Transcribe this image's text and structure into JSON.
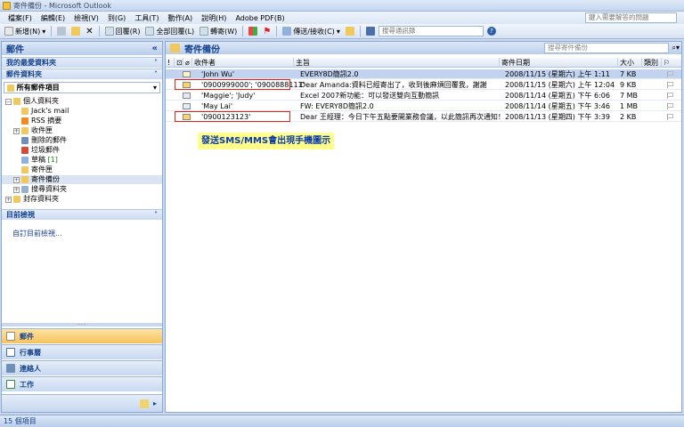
{
  "window": {
    "title": "寄件備份 - Microsoft Outlook"
  },
  "menu": [
    "檔案(F)",
    "編輯(E)",
    "檢視(V)",
    "到(G)",
    "工具(T)",
    "動作(A)",
    "說明(H)",
    "Adobe PDF(B)"
  ],
  "help": {
    "placeholder": "鍵入需要解答的問題"
  },
  "toolbar": {
    "new": "新增(N)",
    "reply": "回覆(R)",
    "reply_all": "全部回覆(L)",
    "forward": "轉寄(W)",
    "send_receive": "傳送/接收(C)",
    "address_book": "搜尋通訊錄"
  },
  "nav": {
    "title": "郵件",
    "favorites": "我的最愛資料夾",
    "mail_folders": "郵件資料夾",
    "all_items": "所有郵件項目",
    "tree": [
      {
        "label": "個人資料夾",
        "count": ""
      },
      {
        "label": "Jack's mail",
        "count": ""
      },
      {
        "label": "RSS 摘要",
        "count": ""
      },
      {
        "label": "收件匣",
        "count": ""
      },
      {
        "label": "刪除的郵件",
        "count": ""
      },
      {
        "label": "垃圾郵件",
        "count": ""
      },
      {
        "label": "草稿",
        "count": "[1]"
      },
      {
        "label": "寄件匣",
        "count": ""
      },
      {
        "label": "寄件備份",
        "count": ""
      },
      {
        "label": "搜尋資料夾",
        "count": ""
      },
      {
        "label": "封存資料夾",
        "count": ""
      }
    ],
    "current_view": "目前檢視",
    "customize_view": "自訂目前檢視...",
    "buttons": [
      "郵件",
      "行事曆",
      "連絡人",
      "工作"
    ]
  },
  "main": {
    "title": "寄件備份",
    "search_placeholder": "搜尋寄件備份",
    "columns": {
      "to": "收件者",
      "subject": "主旨",
      "date": "寄件日期",
      "size": "大小",
      "category": "類別"
    },
    "rows": [
      {
        "to": "'John Wu'",
        "subject": "EVERY8D簡訊2.0",
        "date": "2008/11/15 (星期六) 上午 1:11",
        "size": "7 KB"
      },
      {
        "to": "'0900999000'; '0900888111'",
        "subject": "Dear Amanda:資料已經寄出了，收到後麻煩回覆我，謝謝",
        "date": "2008/11/15 (星期六) 上午 12:04",
        "size": "9 KB"
      },
      {
        "to": "'Maggie'; 'Judy'",
        "subject": "Excel 2007新功能：可以發送雙向互動簡訊",
        "date": "2008/11/14 (星期五) 下午 6:06",
        "size": "7 MB"
      },
      {
        "to": "'May Lai'",
        "subject": "FW: EVERY8D簡訊2.0",
        "date": "2008/11/14 (星期五) 下午 3:46",
        "size": "1 MB"
      },
      {
        "to": "'0900123123'",
        "subject": "Dear 王經理：今日下午五點要開業務會議，以此簡訊再次通知！",
        "date": "2008/11/13 (星期四) 下午 3:39",
        "size": "2 KB"
      }
    ],
    "annotation": "發送SMS/MMS會出現手機圖示"
  },
  "status": {
    "text": "15 個項目"
  }
}
